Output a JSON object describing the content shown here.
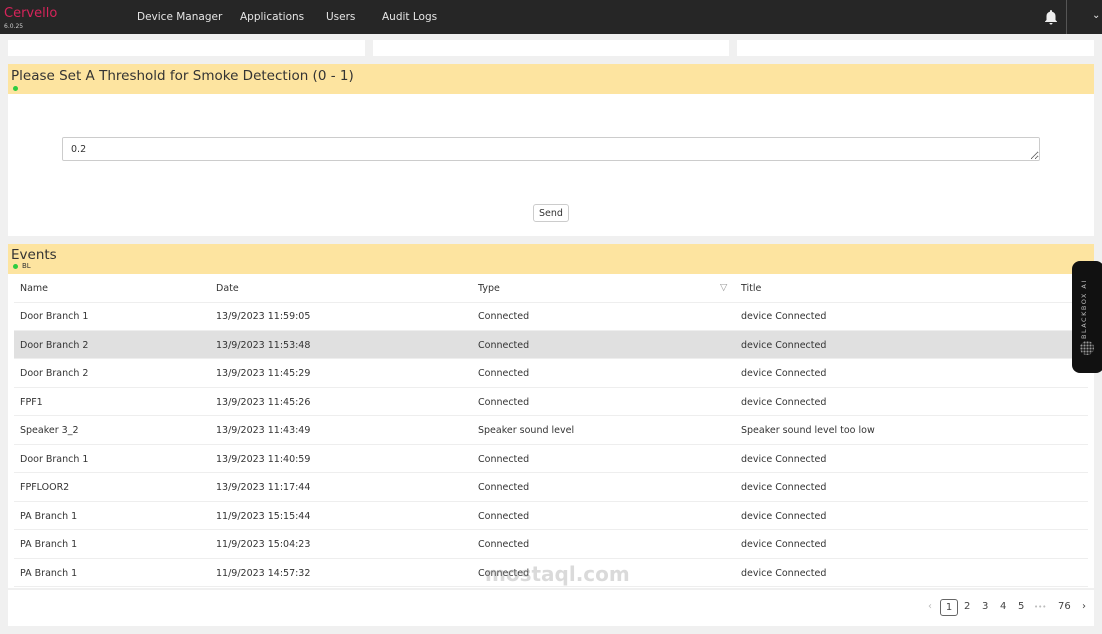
{
  "nav": {
    "brand": "Cervello",
    "version": "6.0.25",
    "items": [
      "Device Manager",
      "Applications",
      "Users",
      "Audit Logs"
    ],
    "brand_color": "#d6245a"
  },
  "threshold": {
    "title": "Please Set A Threshold for Smoke Detection (0 - 1)",
    "value": "0.2",
    "send": "Send"
  },
  "events": {
    "title": "Events",
    "subtitle": "BL",
    "columns": [
      "Name",
      "Date",
      "Type",
      "Title"
    ],
    "rows": [
      [
        "Door Branch 1",
        "13/9/2023 11:59:05",
        "Connected",
        "device Connected"
      ],
      [
        "Door Branch 2",
        "13/9/2023 11:53:48",
        "Connected",
        "device Connected"
      ],
      [
        "Door Branch 2",
        "13/9/2023 11:45:29",
        "Connected",
        "device Connected"
      ],
      [
        "FPF1",
        "13/9/2023 11:45:26",
        "Connected",
        "device Connected"
      ],
      [
        "Speaker 3_2",
        "13/9/2023 11:43:49",
        "Speaker sound level",
        "Speaker sound level too low"
      ],
      [
        "Door Branch 1",
        "13/9/2023 11:40:59",
        "Connected",
        "device Connected"
      ],
      [
        "FPFLOOR2",
        "13/9/2023 11:17:44",
        "Connected",
        "device Connected"
      ],
      [
        "PA Branch 1",
        "11/9/2023 15:15:44",
        "Connected",
        "device Connected"
      ],
      [
        "PA Branch 1",
        "11/9/2023 15:04:23",
        "Connected",
        "device Connected"
      ],
      [
        "PA Branch 1",
        "11/9/2023 14:57:32",
        "Connected",
        "device Connected"
      ]
    ]
  },
  "pagination": {
    "pages": [
      "1",
      "2",
      "3",
      "4",
      "5"
    ],
    "ellipsis": "•••",
    "last": "76",
    "current": "1"
  },
  "widget": {
    "label": "BLACKBOX AI"
  },
  "watermark": "mostaql.com"
}
